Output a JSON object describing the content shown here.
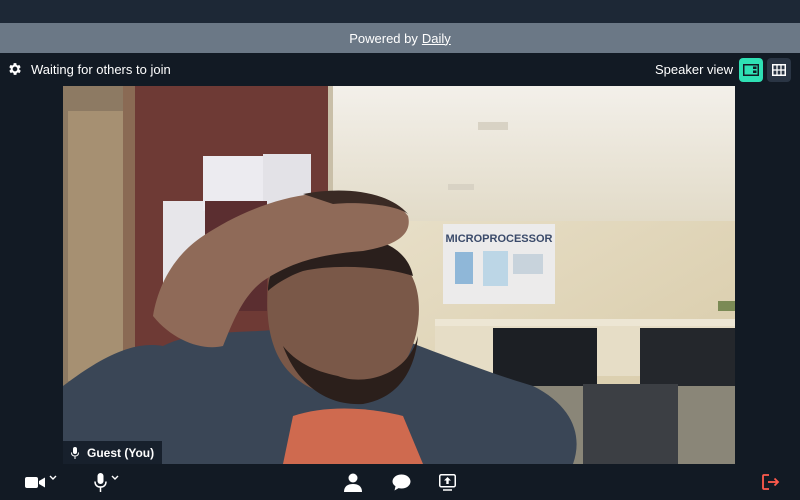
{
  "banner": {
    "prefix": "Powered by",
    "link": "Daily"
  },
  "header": {
    "status": "Waiting for others to join",
    "view_label": "Speaker view"
  },
  "participant": {
    "name": "Guest (You)"
  },
  "poster": {
    "text": "MICROPROCESSOR"
  },
  "colors": {
    "accent": "#2fe0b4",
    "leave": "#ff5a4d",
    "banner": "#6b7886",
    "background": "#121a24"
  },
  "icons": {
    "settings": "gear-icon",
    "speaker_view": "speaker-view-icon",
    "grid_view": "grid-view-icon",
    "camera": "camera-icon",
    "microphone": "microphone-icon",
    "people": "people-icon",
    "chat": "chat-icon",
    "screenshare": "screenshare-icon",
    "leave": "leave-icon"
  }
}
